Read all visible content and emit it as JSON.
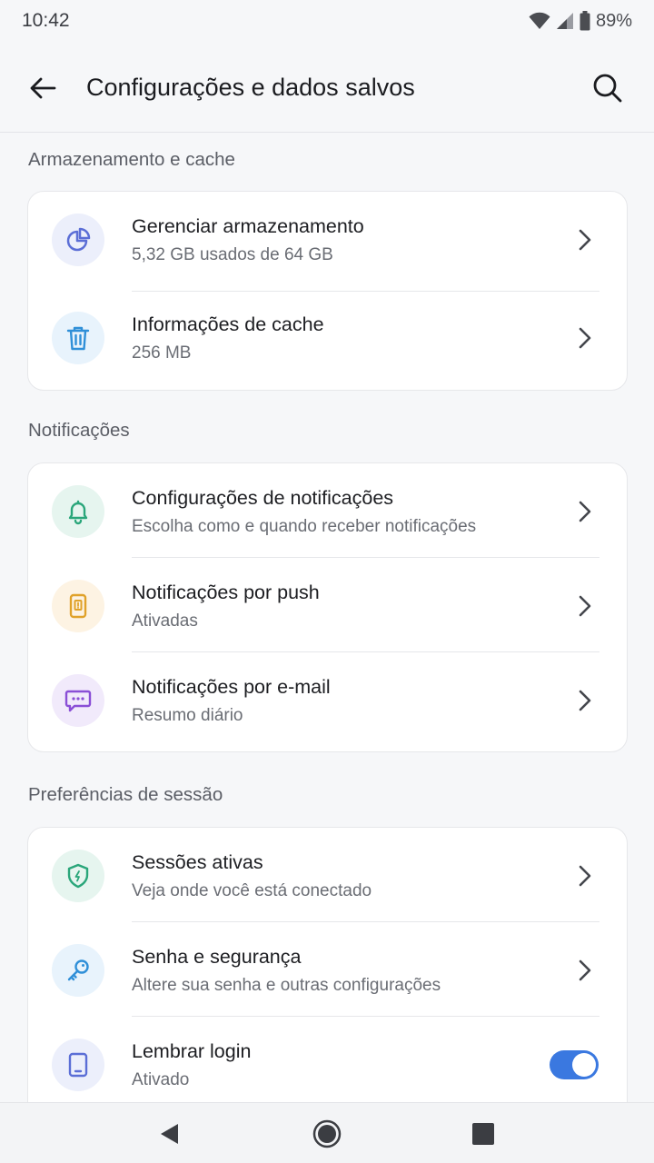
{
  "status": {
    "time": "10:42",
    "battery": "89%"
  },
  "header": {
    "title": "Configurações e dados salvos"
  },
  "sections": [
    {
      "label": "Armazenamento e cache",
      "items": [
        {
          "title": "Gerenciar armazenamento",
          "subtitle": "5,32 GB usados de 64 GB",
          "icon": "pie-chart-icon",
          "color": "#5b6ed6",
          "bg": "#eceffb"
        },
        {
          "title": "Informações de cache",
          "subtitle": "256 MB",
          "icon": "trash-icon",
          "color": "#2f8fd8",
          "bg": "#e8f3fc"
        }
      ]
    },
    {
      "label": "Notificações",
      "items": [
        {
          "title": "Configurações de notificações",
          "subtitle": "Escolha como e quando receber notificações",
          "icon": "bell-icon",
          "color": "#2aa67a",
          "bg": "#e6f5ef"
        },
        {
          "title": "Notificações por push",
          "subtitle": "Ativadas",
          "icon": "phone-alert-icon",
          "color": "#e0a22a",
          "bg": "#fdf3e3"
        },
        {
          "title": "Notificações por e-mail",
          "subtitle": "Resumo diário",
          "icon": "chat-icon",
          "color": "#8a4fd6",
          "bg": "#f1eafb"
        }
      ]
    },
    {
      "label": "Preferências de sessão",
      "items": [
        {
          "title": "Sessões ativas",
          "subtitle": "Veja onde você está conectado",
          "icon": "shield-icon",
          "color": "#2aa67a",
          "bg": "#e6f5ef"
        },
        {
          "title": "Senha e segurança",
          "subtitle": "Altere sua senha e outras configurações",
          "icon": "key-icon",
          "color": "#2f8fd8",
          "bg": "#e8f3fc"
        },
        {
          "title": "Lembrar login",
          "subtitle": "Ativado",
          "icon": "tablet-icon",
          "color": "#5b6ed6",
          "bg": "#eceffb",
          "toggle_on": true
        }
      ]
    }
  ]
}
